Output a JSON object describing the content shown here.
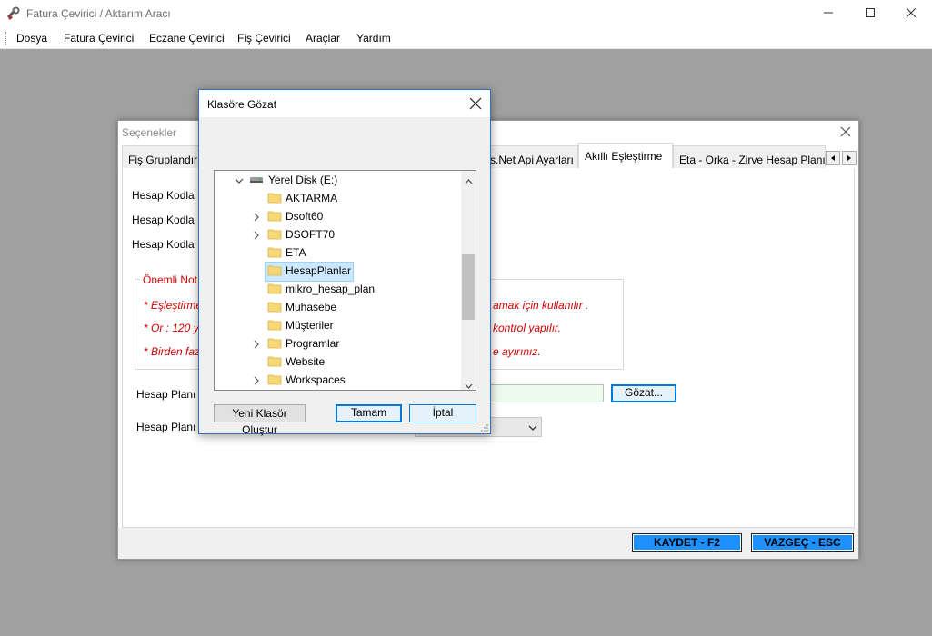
{
  "window": {
    "title": "Fatura Çevirici / Aktarım Aracı"
  },
  "menu": {
    "items": [
      "Dosya",
      "Fatura Çevirici",
      "Eczane Çevirici",
      "Fiş Çevirici",
      "Araçlar",
      "Yardım"
    ]
  },
  "options_window": {
    "title": "Seçenekler",
    "tabs": [
      "Fiş Gruplandırı",
      "s.Net Api Ayarları",
      "Akıllı Eşleştirme",
      "Eta - Orka - Zirve Hesap Planı"
    ],
    "active_tab": "Akıllı Eşleştirme",
    "labels": [
      "Hesap Kodla",
      "Hesap Kodla",
      "Hesap Kodla"
    ],
    "notes_title": "Önemli Not",
    "notes_left": [
      "* Eşleştirme",
      "* Ör : 120 y",
      "* Birden faz"
    ],
    "notes_right": [
      "amak için kullanılır .",
      "kontrol yapılır.",
      "e ayırınız."
    ],
    "plan_label_1": "Hesap Planı",
    "plan_label_2": "Hesap Planı",
    "path_value": "",
    "browse_button": "Gözat...",
    "save_button": "KAYDET - F2",
    "cancel_button": "VAZGEÇ - ESC"
  },
  "folder_dialog": {
    "title": "Klasöre Gözat",
    "drive": "Yerel Disk (E:)",
    "folders": [
      {
        "name": "AKTARMA",
        "expandable": false,
        "selected": false
      },
      {
        "name": "Dsoft60",
        "expandable": true,
        "selected": false
      },
      {
        "name": "DSOFT70",
        "expandable": true,
        "selected": false
      },
      {
        "name": "ETA",
        "expandable": false,
        "selected": false
      },
      {
        "name": "HesapPlanlar",
        "expandable": false,
        "selected": true
      },
      {
        "name": "mikro_hesap_plan",
        "expandable": false,
        "selected": false
      },
      {
        "name": "Muhasebe",
        "expandable": false,
        "selected": false
      },
      {
        "name": "Müşteriler",
        "expandable": false,
        "selected": false
      },
      {
        "name": "Programlar",
        "expandable": true,
        "selected": false
      },
      {
        "name": "Website",
        "expandable": false,
        "selected": false
      },
      {
        "name": "Workspaces",
        "expandable": true,
        "selected": false
      }
    ],
    "new_folder_button": "Yeni Klasör Oluştur",
    "ok_button": "Tamam",
    "cancel_button": "İptal"
  },
  "colors": {
    "accent_blue": "#1e90ff",
    "selection": "#cce8ff",
    "note_red": "#d40000",
    "folder_yellow": "#f8d775"
  }
}
